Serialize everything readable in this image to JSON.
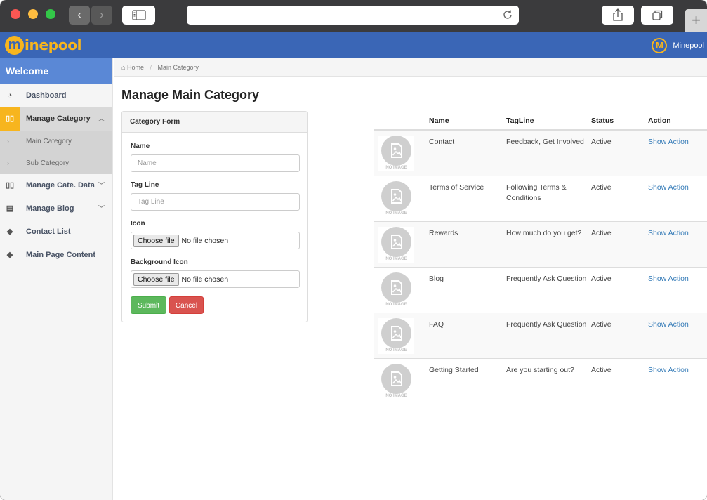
{
  "browser": {
    "new_tab_label": "+"
  },
  "header": {
    "logo_m": "m",
    "logo_text": "inepool",
    "user_initial": "M",
    "user_name": "Minepool"
  },
  "sidebar": {
    "welcome": "Welcome",
    "items": [
      {
        "label": "Dashboard",
        "icon": "dashboard-icon"
      },
      {
        "label": "Manage Category",
        "icon": "book-icon"
      },
      {
        "label": "Manage Cate. Data",
        "icon": "book-icon"
      },
      {
        "label": "Manage Blog",
        "icon": "file-icon"
      },
      {
        "label": "Contact List",
        "icon": "tags-icon"
      },
      {
        "label": "Main Page Content",
        "icon": "tags-icon"
      }
    ],
    "subitems": [
      {
        "label": "Main Category"
      },
      {
        "label": "Sub Category"
      }
    ]
  },
  "breadcrumb": {
    "home": "Home",
    "current": "Main Category"
  },
  "page": {
    "title": "Manage Main Category"
  },
  "form": {
    "title": "Category Form",
    "name_label": "Name",
    "name_placeholder": "Name",
    "tagline_label": "Tag Line",
    "tagline_placeholder": "Tag Line",
    "icon_label": "Icon",
    "bg_icon_label": "Background Icon",
    "choose_file": "Choose file",
    "no_file": "No file chosen",
    "submit": "Submit",
    "cancel": "Cancel"
  },
  "table": {
    "headers": {
      "name": "Name",
      "tagline": "TagLine",
      "status": "Status",
      "action": "Action"
    },
    "no_image_text": "NO IMAGE",
    "rows": [
      {
        "name": "Contact",
        "tagline": "Feedback, Get Involved",
        "status": "Active",
        "action": "Show Action"
      },
      {
        "name": "Terms of Service",
        "tagline": "Following Terms & Conditions",
        "status": "Active",
        "action": "Show Action"
      },
      {
        "name": "Rewards",
        "tagline": "How much do you get?",
        "status": "Active",
        "action": "Show Action"
      },
      {
        "name": "Blog",
        "tagline": "Frequently Ask Question",
        "status": "Active",
        "action": "Show Action"
      },
      {
        "name": "FAQ",
        "tagline": "Frequently Ask Question",
        "status": "Active",
        "action": "Show Action"
      },
      {
        "name": "Getting Started",
        "tagline": "Are you starting out?",
        "status": "Active",
        "action": "Show Action"
      }
    ]
  },
  "colors": {
    "header": "#3a66b6",
    "welcome": "#5a88d6",
    "accent": "#f7b51e",
    "submit": "#5cb85c",
    "cancel": "#d9534f",
    "link": "#337ab7"
  }
}
